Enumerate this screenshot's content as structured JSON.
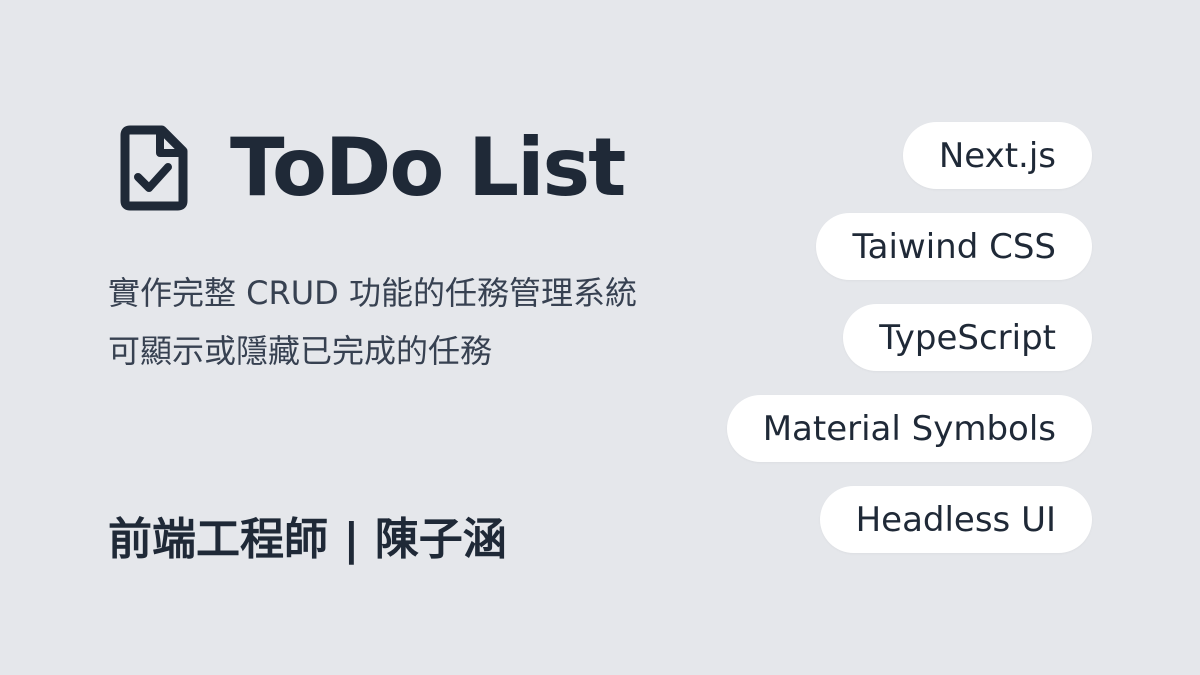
{
  "header": {
    "title": "ToDo List",
    "icon": "file-check-icon"
  },
  "description": {
    "lines": [
      "實作完整 CRUD 功能的任務管理系統",
      "可顯示或隱藏已完成的任務"
    ]
  },
  "author": {
    "text": "前端工程師 | 陳子涵"
  },
  "tags": [
    {
      "label": "Next.js"
    },
    {
      "label": "Taiwind CSS"
    },
    {
      "label": "TypeScript"
    },
    {
      "label": "Material Symbols"
    },
    {
      "label": "Headless UI"
    }
  ],
  "colors": {
    "background": "#e5e7eb",
    "text": "#1f2937",
    "tag_bg": "#ffffff"
  }
}
